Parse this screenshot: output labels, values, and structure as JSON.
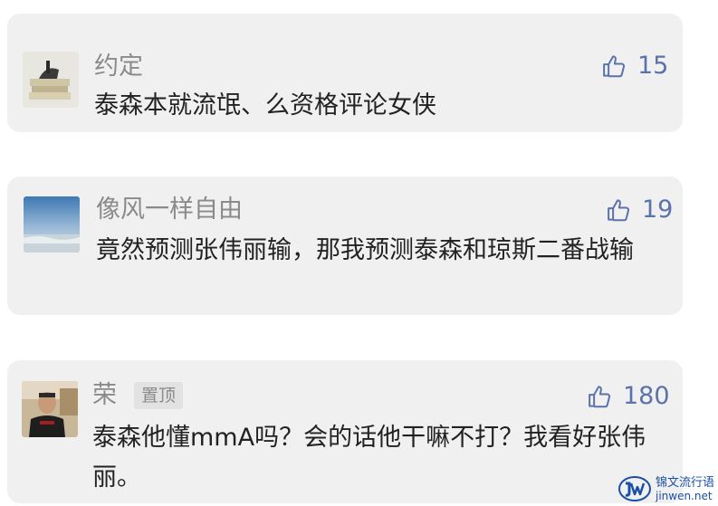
{
  "comments": [
    {
      "username": "约定",
      "badge": "",
      "likes": "15",
      "text": "泰森本就流氓、么资格评论女侠",
      "avatar_icon": "avatar-image"
    },
    {
      "username": "像风一样自由",
      "badge": "",
      "likes": "19",
      "text": "竟然预测张伟丽输，那我预测泰森和琼斯二番战输",
      "avatar_icon": "avatar-image"
    },
    {
      "username": "荣",
      "badge": "置顶",
      "likes": "180",
      "text": "泰森他懂mmA吗？会的话他干嘛不打？我看好张伟丽。",
      "avatar_icon": "avatar-image"
    }
  ],
  "watermark": {
    "cn": "锦文流行语",
    "en": "jinwen.net"
  },
  "colors": {
    "card_bg": "#f0f0f0",
    "username": "#8a8a8a",
    "like": "#5a73a8",
    "text": "#222222"
  }
}
